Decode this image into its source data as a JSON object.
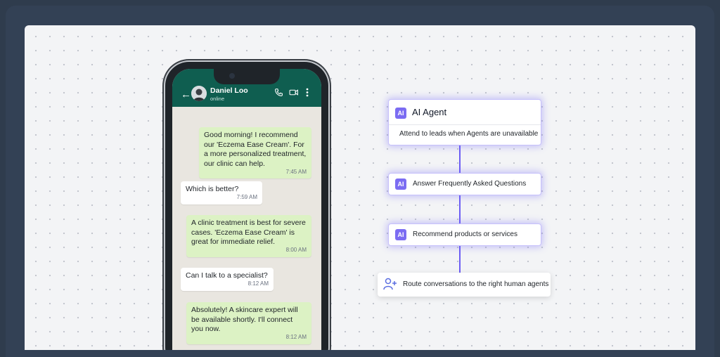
{
  "chat": {
    "contact_name": "Daniel Loo",
    "contact_status": "online",
    "messages": [
      {
        "direction": "out",
        "text": "Good morning! I recommend our 'Eczema Ease Cream'. For a more personalized treatment, our clinic can help.",
        "time": "7:45 AM"
      },
      {
        "direction": "in",
        "text": "Which is better?",
        "time": "7:59 AM"
      },
      {
        "direction": "out",
        "text": "A clinic treatment is best for severe cases. 'Eczema Ease Cream' is great for immediate relief.",
        "time": "8:00 AM"
      },
      {
        "direction": "in",
        "text": "Can I talk to a specialist?",
        "time": "8:12 AM"
      },
      {
        "direction": "out",
        "text": "Absolutely! A skincare expert will be available shortly. I'll connect you now.",
        "time": "8:12 AM"
      }
    ]
  },
  "flow": {
    "badge": "AI",
    "agent": {
      "title": "AI Agent",
      "description": "Attend to leads when Agents are unavailable"
    },
    "steps": [
      {
        "label": "Answer Frequently Asked Questions"
      },
      {
        "label": "Recommend products or services"
      }
    ],
    "human_step": {
      "label": "Route conversations to the right human agents",
      "icon": "person-add-icon"
    }
  },
  "colors": {
    "accent": "#7b6cf2",
    "whatsapp_header": "#0f5e50",
    "outgoing_bubble": "#dcf2c4",
    "page_background": "#2f3c4d"
  }
}
